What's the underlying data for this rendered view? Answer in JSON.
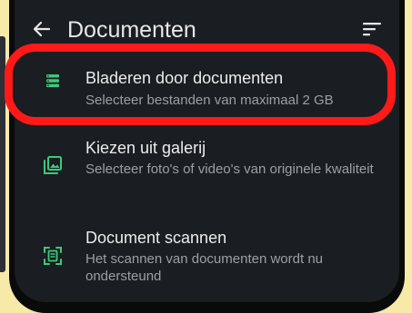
{
  "header": {
    "title": "Documenten",
    "back_icon": "arrow-left-icon",
    "sort_icon": "sort-icon"
  },
  "options": [
    {
      "label": "Bladeren door documenten",
      "description": "Selecteer bestanden van maximaal 2 GB",
      "icon": "storage-list-icon"
    },
    {
      "label": "Kiezen uit galerij",
      "description": "Selecteer foto's of video's van originele kwaliteit",
      "icon": "gallery-icon"
    },
    {
      "label": "Document scannen",
      "description": "Het scannen van documenten wordt nu ondersteund",
      "icon": "document-scan-icon"
    }
  ],
  "colors": {
    "accent_green": "#3ec97a",
    "highlight_red": "#ff1a1a",
    "background": "#1a1d22"
  }
}
